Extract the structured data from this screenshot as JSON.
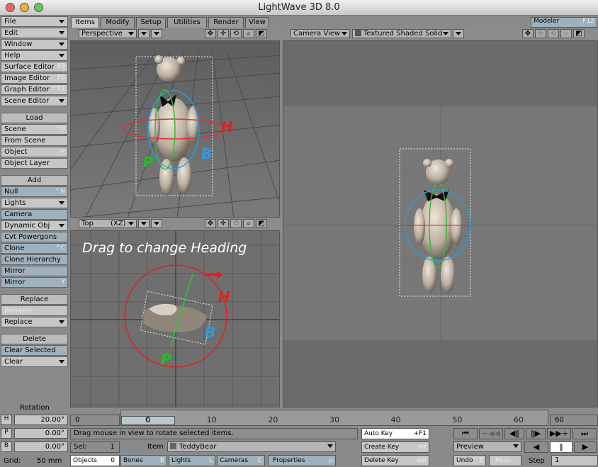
{
  "window": {
    "title": "LightWave 3D 8.0"
  },
  "sidebar": {
    "menus": [
      {
        "label": "File"
      },
      {
        "label": "Edit"
      },
      {
        "label": "Window"
      },
      {
        "label": "Help"
      }
    ],
    "editors": [
      {
        "label": "Surface Editor",
        "shortcut": "F5"
      },
      {
        "label": "Image Editor",
        "shortcut": "F6"
      },
      {
        "label": "Graph Editor",
        "shortcut": "^F2"
      },
      {
        "label": "Scene Editor",
        "shortcut": ""
      }
    ],
    "load": {
      "header": "Load",
      "items": [
        {
          "label": "Scene",
          "shortcut": "^O"
        },
        {
          "label": "From Scene",
          "shortcut": ""
        },
        {
          "label": "Object",
          "shortcut": "+"
        },
        {
          "label": "Object Layer",
          "shortcut": ""
        }
      ]
    },
    "add": {
      "header": "Add",
      "items": [
        {
          "label": "Null",
          "shortcut": "^N"
        },
        {
          "label": "Lights",
          "shortcut": ""
        },
        {
          "label": "Camera",
          "shortcut": ""
        },
        {
          "label": "Dynamic Obj",
          "shortcut": ""
        },
        {
          "label": "Cvt Powergons",
          "shortcut": ""
        },
        {
          "label": "Clone",
          "shortcut": "^C"
        },
        {
          "label": "Clone Hierarchy",
          "shortcut": ""
        },
        {
          "label": "Mirror",
          "shortcut": ""
        },
        {
          "label": "Mirror",
          "shortcut": "Y"
        }
      ]
    },
    "replace": {
      "header": "Replace",
      "items": [
        {
          "label": "Rename",
          "shortcut": ""
        },
        {
          "label": "Replace",
          "shortcut": ""
        }
      ]
    },
    "delete": {
      "header": "Delete",
      "items": [
        {
          "label": "Clear Selected",
          "shortcut": "-"
        },
        {
          "label": "Clear",
          "shortcut": ""
        }
      ]
    }
  },
  "tabs": [
    {
      "label": "Items"
    },
    {
      "label": "Modify"
    },
    {
      "label": "Setup"
    },
    {
      "label": "Utilities"
    },
    {
      "label": "Render"
    },
    {
      "label": "View"
    }
  ],
  "modeler": {
    "label": "Modeler",
    "shortcut": "F12"
  },
  "viewports": {
    "persp": {
      "view": "Perspective"
    },
    "top": {
      "view": "Top",
      "axis": "(XZ)",
      "hint": "Drag to change Heading"
    },
    "camera": {
      "view": "Camera View",
      "mode": "Textured Shaded Solid"
    }
  },
  "gizmo": {
    "h": "H",
    "p": "P",
    "b": "B"
  },
  "bottom": {
    "rotation_label": "Rotation",
    "h": {
      "label": "H",
      "value": "20.00°"
    },
    "p": {
      "label": "P",
      "value": "0.00°"
    },
    "b": {
      "label": "B",
      "value": "0.00°"
    },
    "grid": {
      "label": "Grid:",
      "value": "50 mm"
    },
    "timeline": {
      "start": "0",
      "end": "60",
      "current": "0",
      "ticks": [
        "0",
        "10",
        "20",
        "30",
        "40",
        "50",
        "60"
      ]
    },
    "status": "Drag mouse in view to rotate selected items.",
    "sel": {
      "label": "Sel:",
      "value": "1"
    },
    "item": {
      "label": "Item",
      "value": "TeddyBear"
    },
    "objects": {
      "label": "Objects",
      "count": "0"
    },
    "bones": {
      "label": "Bones",
      "shortcut": "B"
    },
    "lights": {
      "label": "Lights",
      "shortcut": "L"
    },
    "cameras": {
      "label": "Cameras",
      "shortcut": "C"
    },
    "properties": {
      "label": "Properties",
      "shortcut": "p"
    },
    "autokey": {
      "label": "Auto Key",
      "shortcut": "+F1"
    },
    "createkey": {
      "label": "Create Key",
      "shortcut": "ret"
    },
    "deletekey": {
      "label": "Delete Key",
      "shortcut": "del"
    },
    "preview": "Preview",
    "undo": {
      "label": "Undo",
      "shortcut": "^Z"
    },
    "redo": "Redo",
    "step": {
      "label": "Step",
      "value": "1"
    }
  }
}
